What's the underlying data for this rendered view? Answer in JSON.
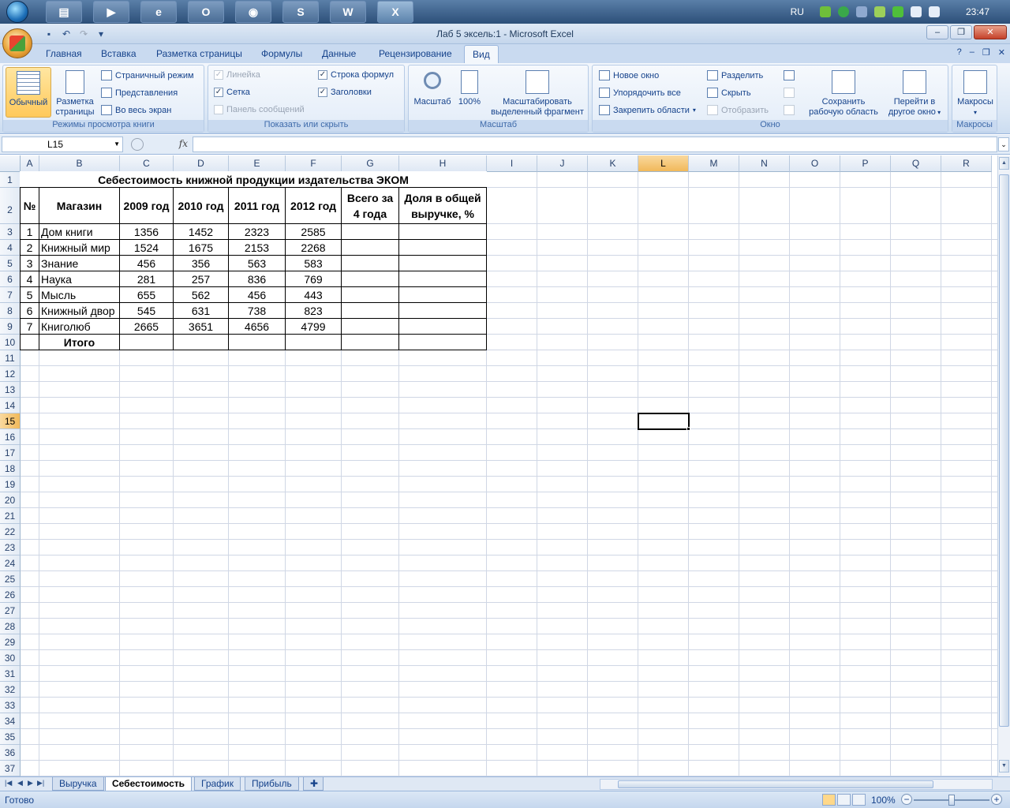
{
  "taskbar": {
    "apps": [
      {
        "name": "explorer",
        "glyph": "▤"
      },
      {
        "name": "media-player",
        "glyph": "▶"
      },
      {
        "name": "internet-explorer",
        "glyph": "e"
      },
      {
        "name": "opera",
        "glyph": "O"
      },
      {
        "name": "chrome",
        "glyph": "◉"
      },
      {
        "name": "skype",
        "glyph": "S"
      },
      {
        "name": "word",
        "glyph": "W"
      },
      {
        "name": "excel",
        "glyph": "X"
      }
    ],
    "language": "RU",
    "clock": "23:47"
  },
  "window": {
    "title": "Лаб 5 эксель:1 - Microsoft Excel"
  },
  "ribbon": {
    "tabs": [
      "Главная",
      "Вставка",
      "Разметка страницы",
      "Формулы",
      "Данные",
      "Рецензирование",
      "Вид"
    ],
    "active_tab": "Вид",
    "groups": {
      "views": {
        "label": "Режимы просмотра книги",
        "normal": "Обычный",
        "page_layout_1": "Разметка",
        "page_layout_2": "страницы",
        "page_break": "Страничный режим",
        "custom_views": "Представления",
        "full_screen": "Во весь экран"
      },
      "show_hide": {
        "label": "Показать или скрыть",
        "ruler": "Линейка",
        "gridlines": "Сетка",
        "message_bar": "Панель сообщений",
        "formula_bar": "Строка формул",
        "headings": "Заголовки"
      },
      "zoom": {
        "label": "Масштаб",
        "zoom": "Масштаб",
        "hundred": "100%",
        "zoom_sel_1": "Масштабировать",
        "zoom_sel_2": "выделенный фрагмент"
      },
      "window": {
        "label": "Окно",
        "new_window": "Новое окно",
        "arrange_all": "Упорядочить все",
        "freeze": "Закрепить области",
        "split": "Разделить",
        "hide": "Скрыть",
        "unhide": "Отобразить",
        "save_ws_1": "Сохранить",
        "save_ws_2": "рабочую область",
        "switch_1": "Перейти в",
        "switch_2": "другое окно"
      },
      "macros": {
        "label": "Макросы",
        "macros": "Макросы"
      }
    }
  },
  "formula_bar": {
    "name_box": "L15",
    "fx": "fx",
    "value": ""
  },
  "grid": {
    "columns": [
      "A",
      "B",
      "C",
      "D",
      "E",
      "F",
      "G",
      "H",
      "I",
      "J",
      "K",
      "L",
      "M",
      "N",
      "O",
      "P",
      "Q",
      "R"
    ],
    "selected_column": "L",
    "selected_row": 15,
    "rows": 37,
    "title": "Себестоимость книжной продукции издательства ЭКОМ",
    "headers": [
      "№",
      "Магазин",
      "2009 год",
      "2010 год",
      "2011 год",
      "2012 год",
      "Всего за 4 года",
      "Доля в общей выручке, %"
    ],
    "header_total_line1": "Всего за",
    "header_total_line2": "4 года",
    "header_share_line1": "Доля в общей",
    "header_share_line2": "выручке, %",
    "data": [
      {
        "n": "1",
        "shop": "Дом книги",
        "y2009": "1356",
        "y2010": "1452",
        "y2011": "2323",
        "y2012": "2585"
      },
      {
        "n": "2",
        "shop": "Книжный мир",
        "y2009": "1524",
        "y2010": "1675",
        "y2011": "2153",
        "y2012": "2268"
      },
      {
        "n": "3",
        "shop": "Знание",
        "y2009": "456",
        "y2010": "356",
        "y2011": "563",
        "y2012": "583"
      },
      {
        "n": "4",
        "shop": "Наука",
        "y2009": "281",
        "y2010": "257",
        "y2011": "836",
        "y2012": "769"
      },
      {
        "n": "5",
        "shop": "Мысль",
        "y2009": "655",
        "y2010": "562",
        "y2011": "456",
        "y2012": "443"
      },
      {
        "n": "6",
        "shop": "Книжный двор",
        "y2009": "545",
        "y2010": "631",
        "y2011": "738",
        "y2012": "823"
      },
      {
        "n": "7",
        "shop": "Книголюб",
        "y2009": "2665",
        "y2010": "3651",
        "y2011": "4656",
        "y2012": "4799"
      }
    ],
    "total_label": "Итого"
  },
  "sheets": {
    "tabs": [
      "Выручка",
      "Себестоимость",
      "График",
      "Прибыль"
    ],
    "active": "Себестоимость"
  },
  "status": {
    "text": "Готово",
    "zoom": "100%"
  }
}
